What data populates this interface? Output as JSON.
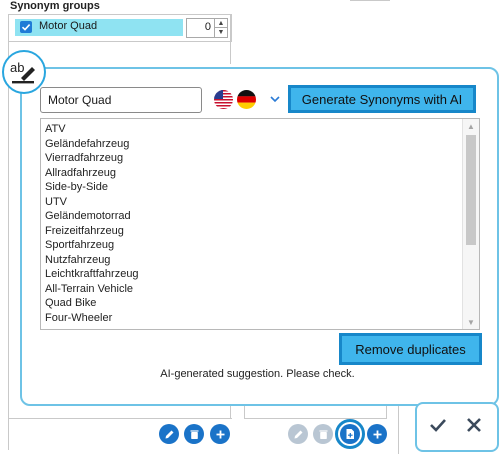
{
  "synonym_groups": {
    "title": "Synonym groups",
    "items": [
      {
        "label": "Motor Quad",
        "checked": true,
        "count": "0"
      }
    ]
  },
  "popup": {
    "term": "Motor Quad",
    "generate_label": "Generate Synonyms with AI",
    "languages": [
      "en-us-flag",
      "de-flag"
    ],
    "synonyms": [
      "ATV",
      "Geländefahrzeug",
      "Vierradfahrzeug",
      "Allradfahrzeug",
      "Side-by-Side",
      "UTV",
      "Geländemotorrad",
      "Freizeitfahrzeug",
      "Sportfahrzeug",
      "Nutzfahrzeug",
      "Leichtkraftfahrzeug",
      "All-Terrain Vehicle",
      "Quad Bike",
      "Four-Wheeler"
    ],
    "remove_duplicates_label": "Remove duplicates",
    "hint": "AI-generated suggestion. Please check."
  },
  "colors": {
    "accent": "#3fb5ec",
    "accent_border": "#1787c9",
    "primary_button": "#1a73c8",
    "selection": "#8fe3f2"
  },
  "icons": {
    "badge": "ab-edit-icon",
    "bottom_left": [
      "pencil-icon",
      "trash-icon",
      "plus-icon"
    ],
    "bottom_mid": [
      "pencil-icon",
      "trash-icon",
      "document-add-icon",
      "plus-icon"
    ],
    "confirm": [
      "check-icon",
      "close-icon"
    ]
  }
}
